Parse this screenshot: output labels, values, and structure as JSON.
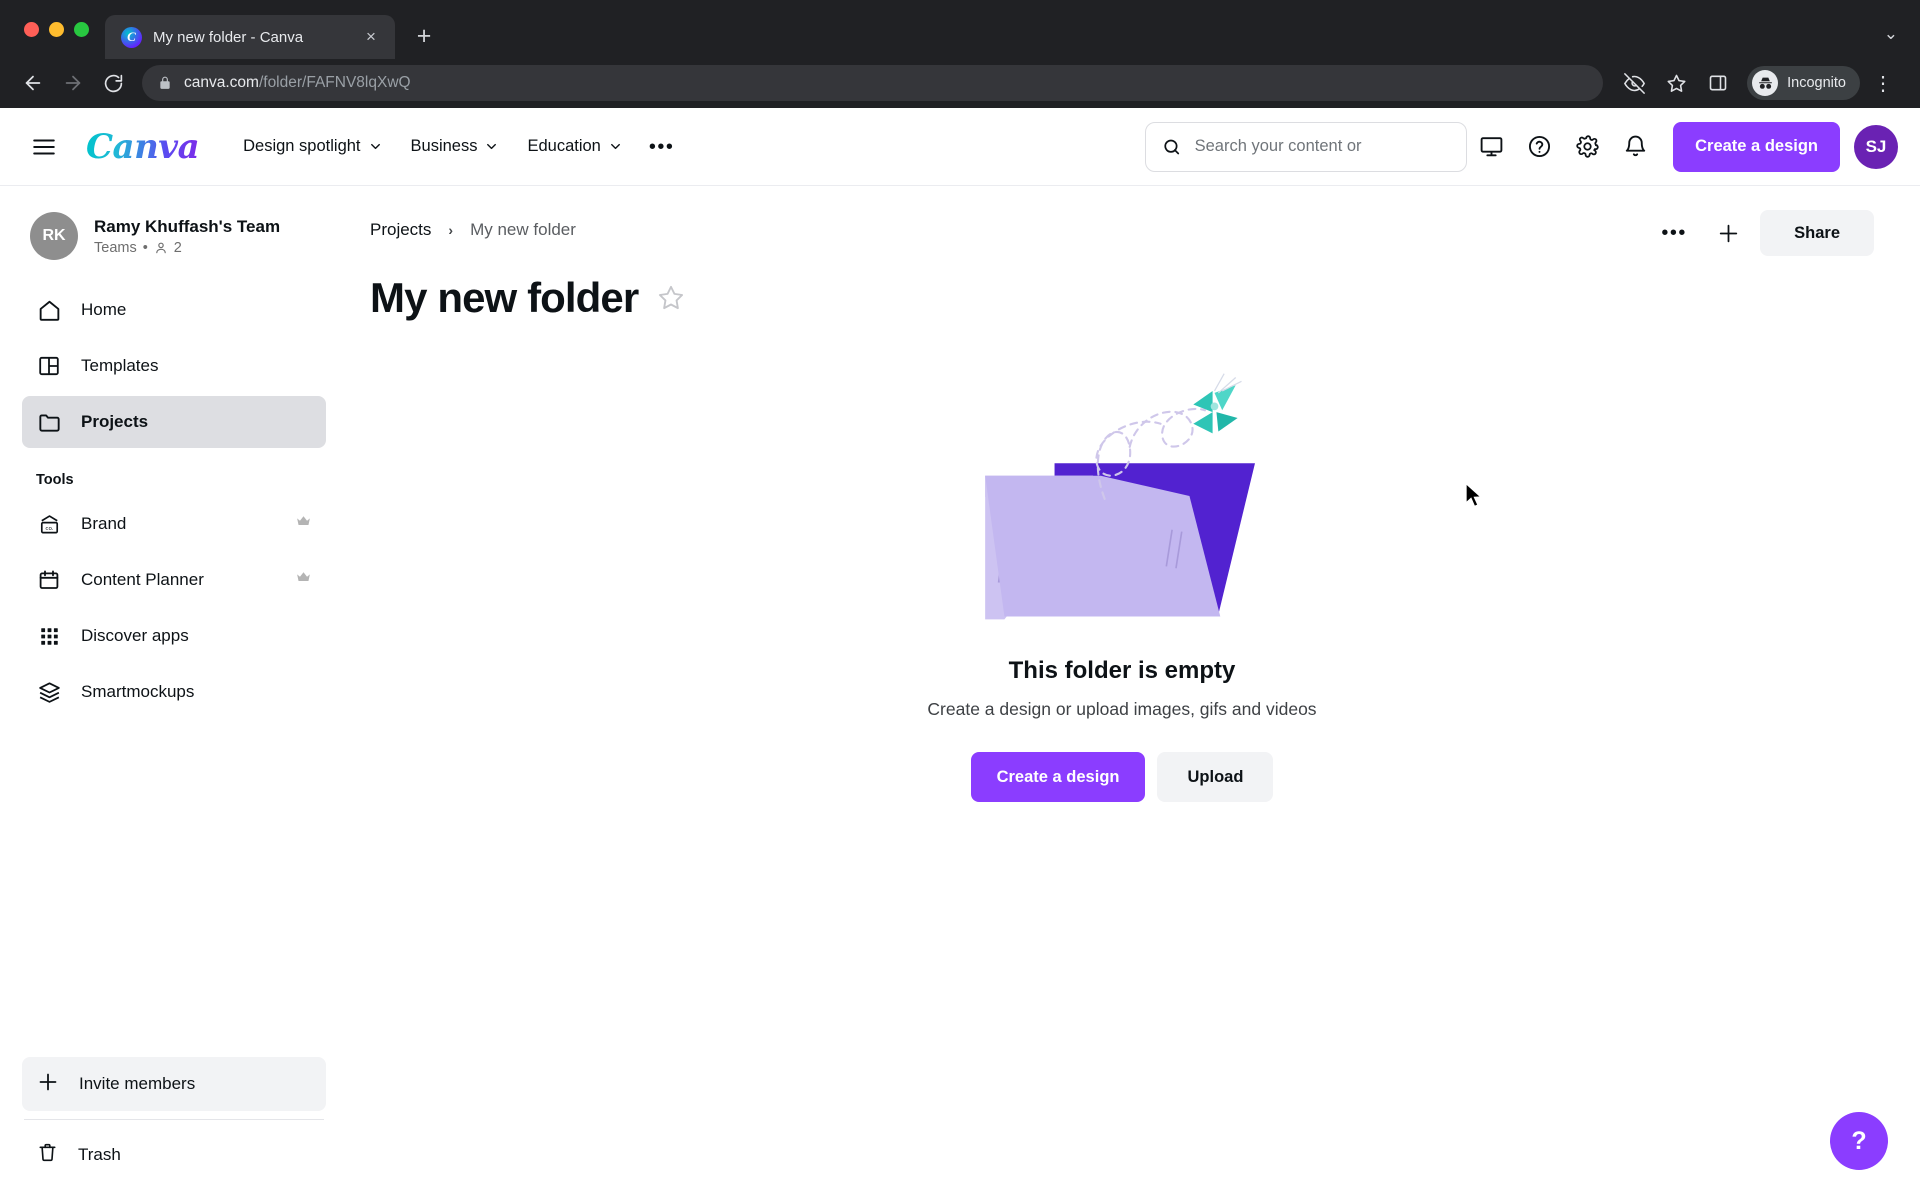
{
  "browser": {
    "tab": {
      "title": "My new folder - Canva",
      "favicon": "canva-favicon",
      "close": "×"
    },
    "new_tab_label": "+",
    "tab_list_chevron": "⌄",
    "toolbar": {
      "back": "back-arrow",
      "forward": "forward-arrow",
      "reload": "reload",
      "url_domain": "canva.com",
      "url_path": "/folder/FAFNV8lqXwQ",
      "url_full": "canva.com/folder/FAFNV8lqXwQ",
      "incognito_label": "Incognito",
      "menu": "⋮"
    }
  },
  "nav": {
    "logo": "Canva",
    "menu_button": "hamburger-menu",
    "items": [
      {
        "label": "Design spotlight",
        "has_chevron": true
      },
      {
        "label": "Business",
        "has_chevron": true
      },
      {
        "label": "Education",
        "has_chevron": true
      }
    ],
    "more_label": "•••",
    "search": {
      "placeholder": "Search your content or",
      "value": ""
    },
    "icons": [
      {
        "name": "display-icon"
      },
      {
        "name": "help-circle-icon"
      },
      {
        "name": "gear-icon"
      },
      {
        "name": "bell-icon"
      }
    ],
    "create_label": "Create a design",
    "avatar_initials": "SJ",
    "accent_color": "#8b3dff"
  },
  "sidebar": {
    "team": {
      "initials": "RK",
      "name": "Ramy Khuffash's Team",
      "meta_label": "Teams",
      "meta_separator": "•",
      "member_count": "2"
    },
    "items": [
      {
        "label": "Home",
        "icon": "home-icon",
        "active": false
      },
      {
        "label": "Templates",
        "icon": "templates-icon",
        "active": false
      },
      {
        "label": "Projects",
        "icon": "folder-icon",
        "active": true
      }
    ],
    "tools_heading": "Tools",
    "tools": [
      {
        "label": "Brand",
        "icon": "brand-icon",
        "pro": true
      },
      {
        "label": "Content Planner",
        "icon": "calendar-icon",
        "pro": true
      },
      {
        "label": "Discover apps",
        "icon": "apps-grid-icon",
        "pro": false
      },
      {
        "label": "Smartmockups",
        "icon": "layers-icon",
        "pro": false
      }
    ],
    "invite_label": "Invite members",
    "trash_label": "Trash"
  },
  "main": {
    "breadcrumb": {
      "parent": "Projects",
      "separator": "›",
      "current": "My new folder"
    },
    "actions": {
      "more_label": "•••",
      "add_label": "+",
      "share_label": "Share"
    },
    "page_title": "My new folder",
    "star_icon": "star-outline-icon",
    "empty_state": {
      "illustration": "empty-folder-butterfly-illustration",
      "title": "This folder is empty",
      "subtitle": "Create a design or upload images, gifs and videos",
      "primary_label": "Create a design",
      "secondary_label": "Upload"
    },
    "help_fab_label": "?"
  }
}
